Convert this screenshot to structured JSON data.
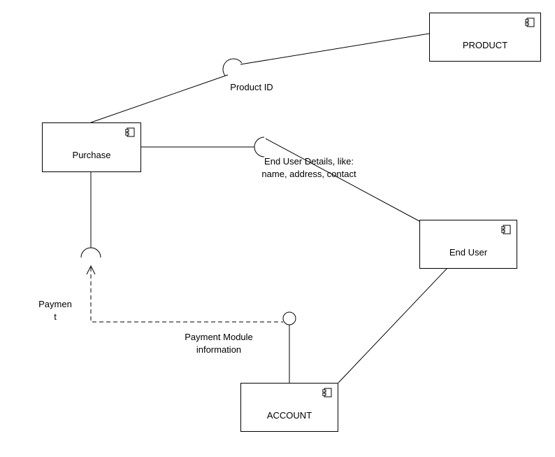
{
  "components": {
    "product": {
      "label": "PRODUCT"
    },
    "purchase": {
      "label": "Purchase"
    },
    "end_user": {
      "label": "End User"
    },
    "account": {
      "label": "ACCOUNT"
    }
  },
  "interfaces": {
    "product_id": {
      "label": "Product ID"
    },
    "end_user_details": {
      "label": "End User Details, like:\nname, address, contact"
    },
    "payment": {
      "label": "Paymen\nt"
    },
    "payment_module": {
      "label": "Payment Module\ninformation"
    }
  }
}
